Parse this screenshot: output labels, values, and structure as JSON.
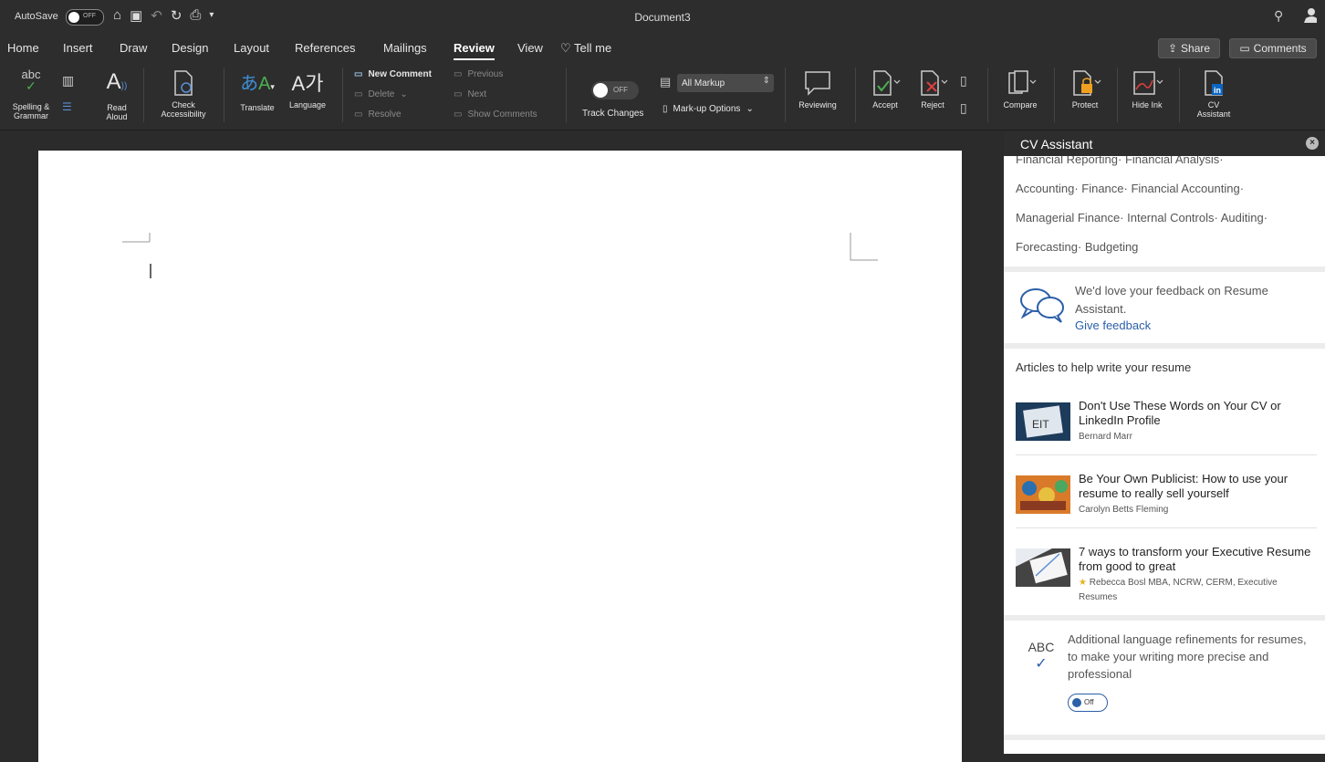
{
  "titlebar": {
    "autosave_label": "AutoSave",
    "autosave_state": "OFF",
    "document_title": "Document3"
  },
  "tabs": [
    {
      "label": "Home"
    },
    {
      "label": "Insert"
    },
    {
      "label": "Draw"
    },
    {
      "label": "Design"
    },
    {
      "label": "Layout"
    },
    {
      "label": "References"
    },
    {
      "label": "Mailings"
    },
    {
      "label": "Review",
      "active": true
    },
    {
      "label": "View"
    },
    {
      "label": "Tell me"
    }
  ],
  "top_buttons": {
    "share": "Share",
    "comments": "Comments"
  },
  "ribbon": {
    "spelling": "Spelling &\nGrammar",
    "spelling_abc": "abc",
    "read_aloud": "Read\nAloud",
    "check_accessibility": "Check\nAccessibility",
    "translate": "Translate",
    "language": "Language",
    "new_comment": "New Comment",
    "delete": "Delete",
    "resolve": "Resolve",
    "previous": "Previous",
    "next": "Next",
    "show_comments": "Show Comments",
    "track_changes": "Track Changes",
    "track_state": "OFF",
    "markup_select": "All Markup",
    "markup_options": "Mark-up Options",
    "reviewing": "Reviewing",
    "accept": "Accept",
    "reject": "Reject",
    "compare": "Compare",
    "protect": "Protect",
    "hide_ink": "Hide Ink",
    "cv_assistant": "CV\nAssistant"
  },
  "pane": {
    "title": "CV Assistant",
    "skills_lines": [
      "Financial Reporting· Financial Analysis·",
      "Accounting· Finance· Financial Accounting·",
      "Managerial Finance· Internal Controls· Auditing·",
      "Forecasting· Budgeting"
    ],
    "feedback_text": "We'd love your feedback on Resume Assistant.",
    "feedback_link": "Give feedback",
    "articles_title": "Articles to help write your resume",
    "articles": [
      {
        "title": "Don't Use These Words on Your CV or LinkedIn Profile",
        "author": "Bernard Marr"
      },
      {
        "title": "Be Your Own Publicist: How to use your resume to really sell yourself",
        "author": "Carolyn Betts Fleming"
      },
      {
        "title": "7 ways to transform your Executive Resume from good to great",
        "author": "Rebecca Bosl  MBA, NCRW, CERM, Executive Resumes"
      }
    ],
    "refinement_icon": "ABC",
    "refinement_text": "Additional language refinements for resumes, to make your writing more precise and professional",
    "refinement_toggle": "Off"
  },
  "accent_color": "#2b5fa8"
}
